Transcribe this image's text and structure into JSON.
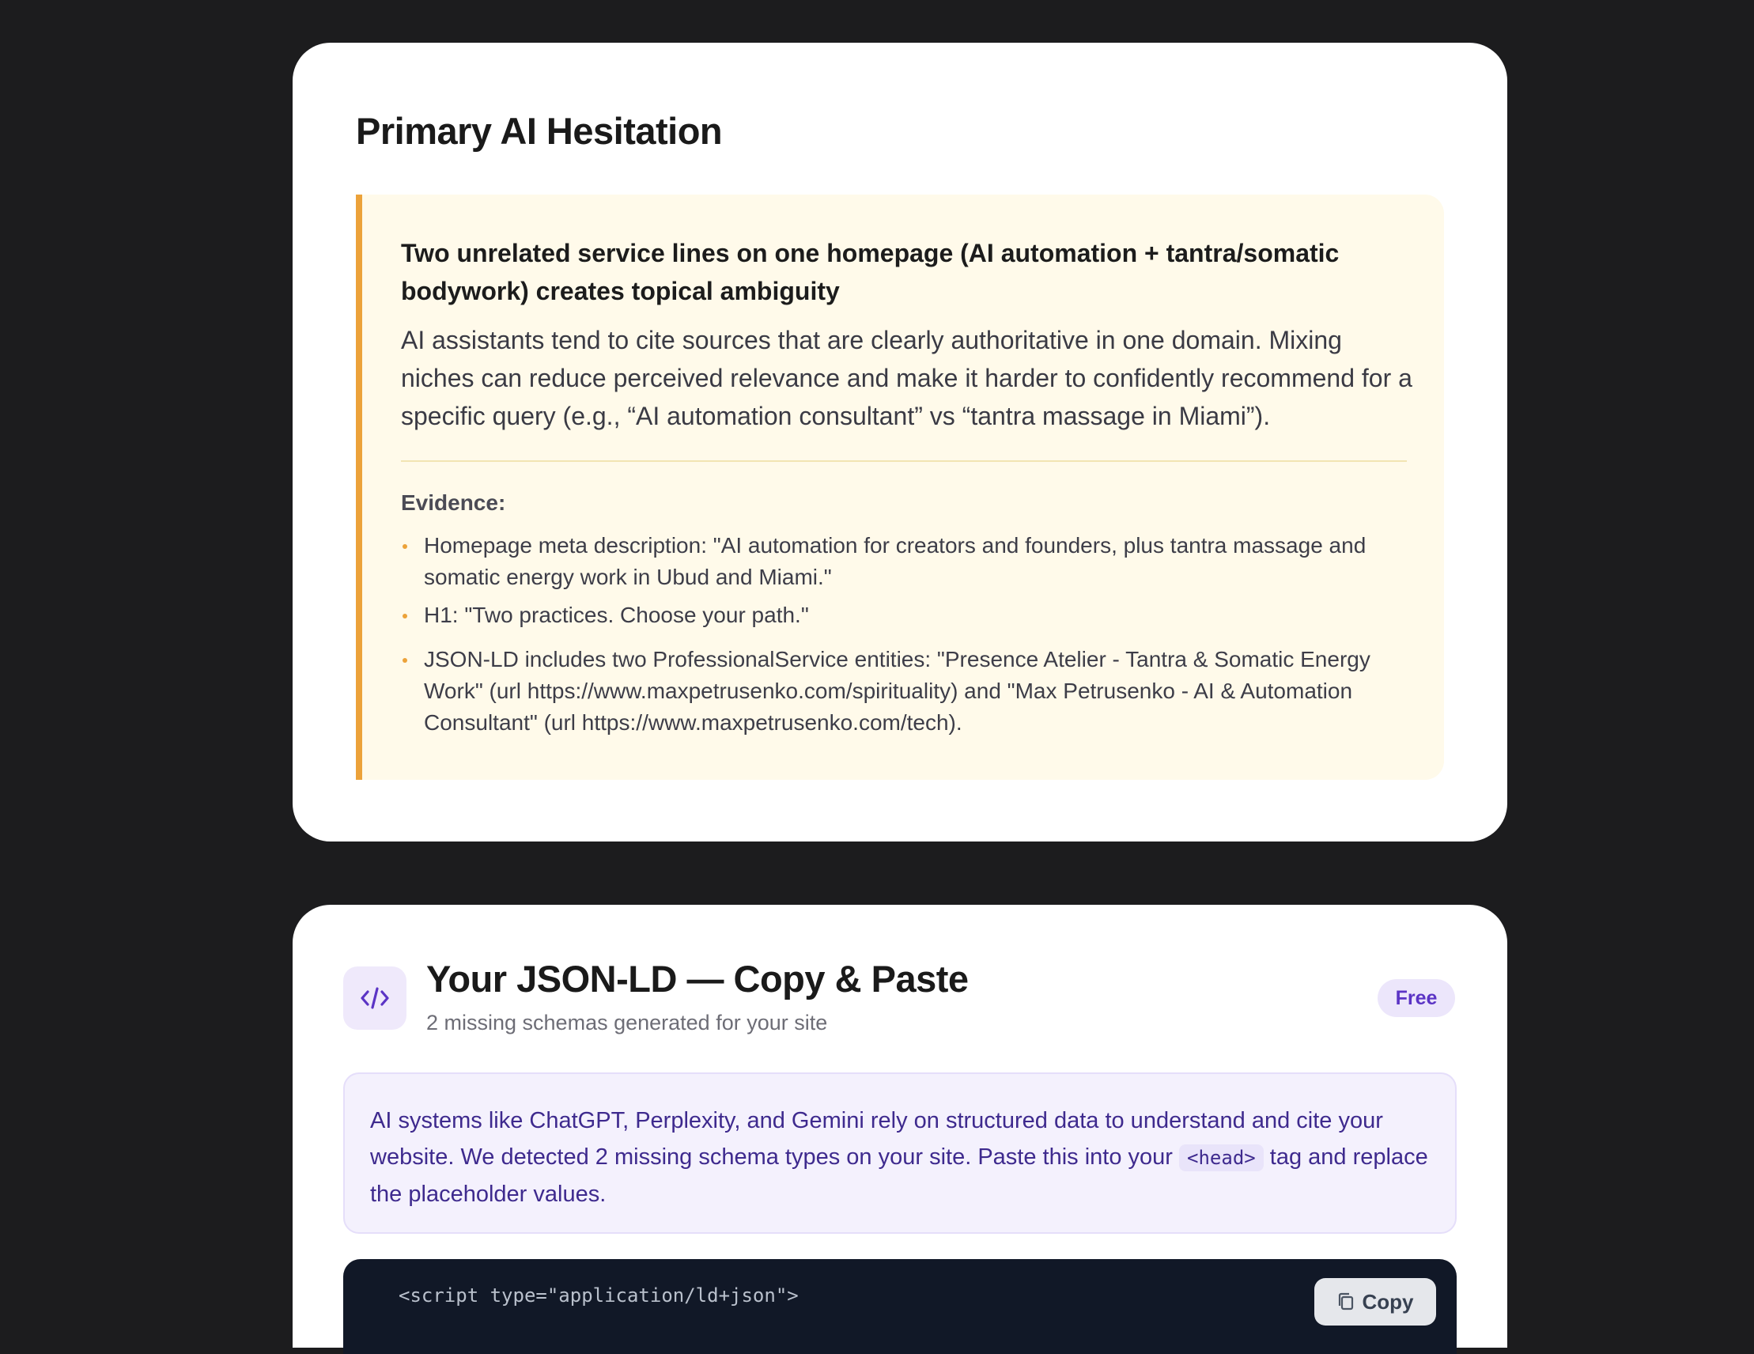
{
  "hesitation": {
    "heading": "Primary AI Hesitation",
    "title": "Two unrelated service lines on one homepage (AI automation + tantra/somatic bodywork) creates topical ambiguity",
    "description": "AI assistants tend to cite sources that are clearly authoritative in one domain. Mixing niches can reduce perceived relevance and make it harder to confidently recommend for a specific query (e.g., “AI automation consultant” vs “tantra massage in Miami”).",
    "evidence_label": "Evidence:",
    "evidence": [
      "Homepage meta description: \"AI automation for creators and founders, plus tantra massage and somatic energy work in Ubud and Miami.\"",
      "H1: \"Two practices. Choose your path.\"",
      "JSON-LD includes two ProfessionalService entities: \"Presence Atelier - Tantra & Somatic Energy Work\" (url https://www.maxpetrusenko.com/spirituality) and \"Max Petrusenko - AI & Automation Consultant\" (url https://www.maxpetrusenko.com/tech)."
    ],
    "accent_color": "#eca23a"
  },
  "jsonld": {
    "icon": "code-icon",
    "title": "Your JSON-LD — Copy & Paste",
    "subtitle": "2 missing schemas generated for your site",
    "badge": "Free",
    "info_part1": "AI systems like ChatGPT, Perplexity, and Gemini rely on structured data to understand and cite your website. We detected 2 missing schema types on your site. Paste this into your ",
    "info_code": "<head>",
    "info_part2": " tag and replace the placeholder values.",
    "code_first_line": "<script type=\"application/ld+json\">",
    "copy_label": "Copy",
    "accent_color": "#5b34c5"
  }
}
